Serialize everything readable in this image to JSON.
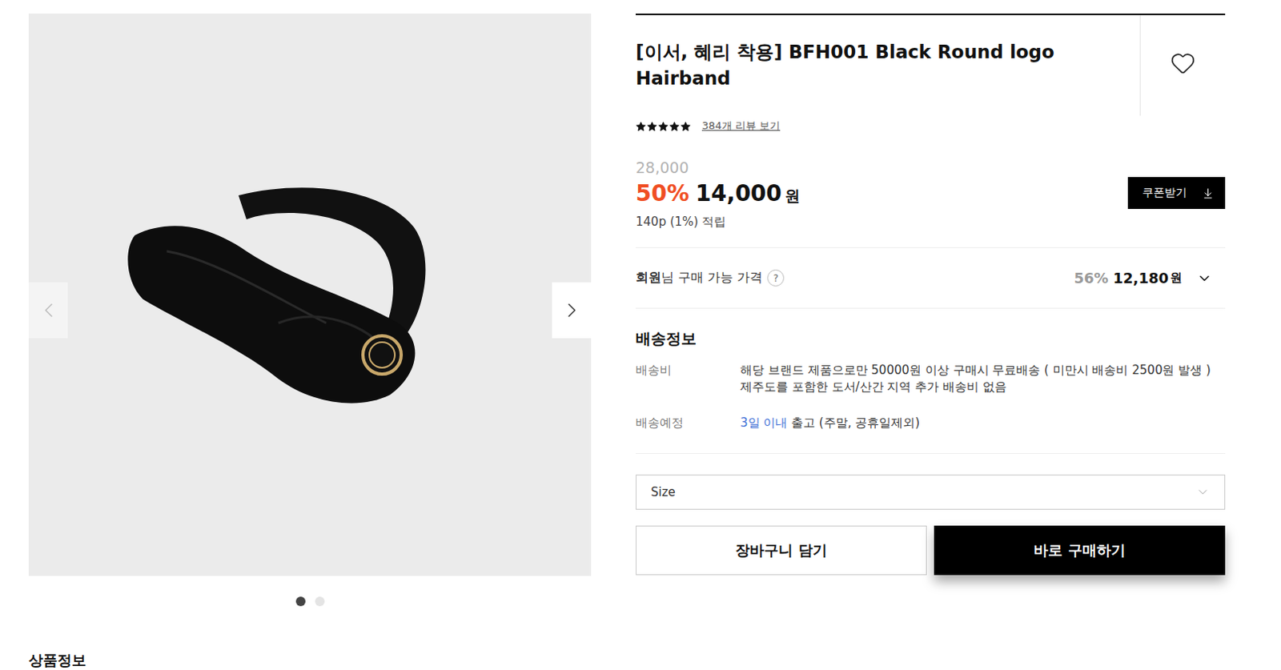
{
  "product_image": {
    "dots": [
      {
        "selected": true
      },
      {
        "selected": false
      }
    ]
  },
  "title": "[이서, 혜리 착용] BFH001 Black Round logo Hairband",
  "wishlist": {
    "selected": false
  },
  "rating": {
    "stars": 5,
    "reviews": "384개 리뷰 보기"
  },
  "price": {
    "original": "28,000",
    "discount": "50%",
    "sale": "14,000",
    "currency": "원",
    "points": "140p (1%) 적립"
  },
  "coupon_button": "쿠폰받기",
  "member_price": {
    "label_bold": "회원",
    "label": "님 구매 가능 가격",
    "help": "?",
    "discount": "56%",
    "price": "12,180",
    "currency": "원",
    "expanded": false
  },
  "shipping": {
    "title": "배송정보",
    "rows": [
      {
        "label": "배송비",
        "parts": [
          {
            "text": "해당 브랜드 제품으로만 50000원 이상 구매시 무료배송 ( 미만시 배송비 2500원 발생 ) 제주도를 포함한 도서/산간 지역 추가 배송비 없음",
            "highlight": false
          }
        ]
      },
      {
        "label": "배송예정",
        "parts": [
          {
            "text": "3일 이내",
            "highlight": true
          },
          {
            "text": " 출고 (주말, 공휴일제외)",
            "highlight": false
          }
        ]
      }
    ]
  },
  "size_select": {
    "placeholder": "Size"
  },
  "buttons": [
    {
      "label": "장바구니 담기",
      "kind": "secondary"
    },
    {
      "label": "바로 구매하기",
      "kind": "primary"
    }
  ],
  "section_title": "상품정보"
}
